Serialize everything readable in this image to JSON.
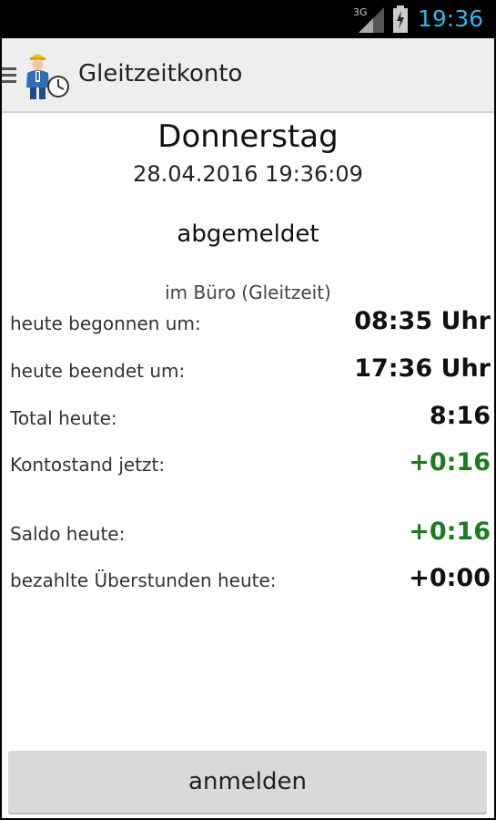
{
  "status_bar": {
    "network": "3G",
    "time": "19:36"
  },
  "action_bar": {
    "title": "Gleitzeitkonto"
  },
  "summary": {
    "day": "Donnerstag",
    "datetime": "28.04.2016 19:36:09",
    "state": "abgemeldet",
    "location": "im Büro (Gleitzeit)"
  },
  "rows": [
    {
      "label": "heute begonnen um:",
      "value": "08:35 Uhr"
    },
    {
      "label": "heute beendet um:",
      "value": "17:36 Uhr"
    },
    {
      "label": "Total heute:",
      "value": "8:16"
    },
    {
      "label": "Kontostand jetzt:",
      "value": "+0:16"
    },
    {
      "label": "Saldo heute:",
      "value": "+0:16"
    },
    {
      "label": "bezahlte Überstunden heute:",
      "value": "+0:00"
    }
  ],
  "button": {
    "label": "anmelden"
  },
  "colors": {
    "accent": "#33b5e5",
    "positive": "#1e7a1e"
  },
  "icons": [
    "signal-icon",
    "battery-charging-icon",
    "menu-icon",
    "app-logo-icon"
  ]
}
